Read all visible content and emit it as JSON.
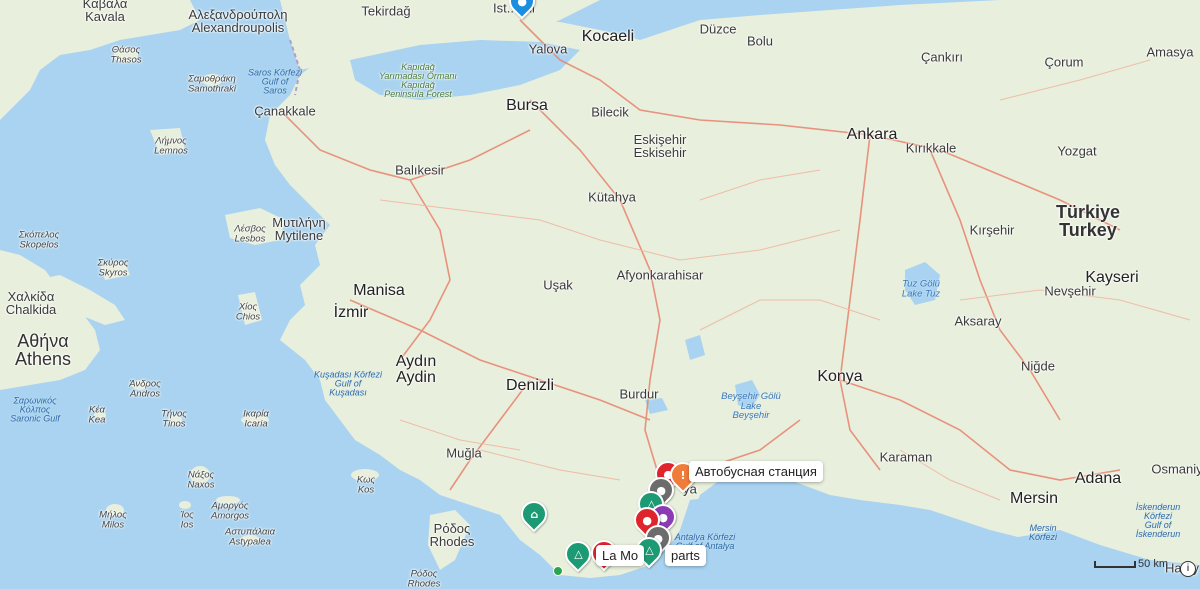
{
  "map": {
    "countries": [
      {
        "id": "turkey",
        "label": "Türkiye\nTurkey"
      },
      {
        "id": "greece",
        "label": "Αθήνα\nAthens"
      }
    ],
    "cities": [
      {
        "id": "istanbul",
        "label": "Ist...bul"
      },
      {
        "id": "tekirdag",
        "label": "Tekirdağ"
      },
      {
        "id": "kavala",
        "label": "Καβάλα\nKavala"
      },
      {
        "id": "alexandroupolis",
        "label": "Αλεξανδρούπολη\nAlexandroupolis"
      },
      {
        "id": "thasos",
        "label": "Θάσος\nThasos"
      },
      {
        "id": "samothraki",
        "label": "Σαμοθράκη\nSamothraki"
      },
      {
        "id": "yalova",
        "label": "Yalova"
      },
      {
        "id": "kocaeli",
        "label": "Kocaeli"
      },
      {
        "id": "duzce",
        "label": "Düzce"
      },
      {
        "id": "bolu",
        "label": "Bolu"
      },
      {
        "id": "cankiri",
        "label": "Çankırı"
      },
      {
        "id": "corum",
        "label": "Çorum"
      },
      {
        "id": "amasya",
        "label": "Amasya"
      },
      {
        "id": "canakkale",
        "label": "Çanakkale"
      },
      {
        "id": "bursa",
        "label": "Bursa"
      },
      {
        "id": "bilecik",
        "label": "Bilecik"
      },
      {
        "id": "eskisehir",
        "label": "Eskişehir\nEskisehir"
      },
      {
        "id": "ankara",
        "label": "Ankara"
      },
      {
        "id": "kirikkale",
        "label": "Kırıkkale"
      },
      {
        "id": "yozgat",
        "label": "Yozgat"
      },
      {
        "id": "lemnos",
        "label": "Λήμνος\nLemnos"
      },
      {
        "id": "balikesir",
        "label": "Balıkesir"
      },
      {
        "id": "kutahya",
        "label": "Kütahya"
      },
      {
        "id": "skopelos",
        "label": "Σκόπελος\nSkopelos"
      },
      {
        "id": "skyros",
        "label": "Σκύρος\nSkyros"
      },
      {
        "id": "lesbos",
        "label": "Λέσβος\nLesbos"
      },
      {
        "id": "mytilene",
        "label": "Μυτιλήνη\nMytilene"
      },
      {
        "id": "kirsehir",
        "label": "Kırşehir"
      },
      {
        "id": "kayseri",
        "label": "Kayseri"
      },
      {
        "id": "chalkida",
        "label": "Χαλκίδα\nChalkida"
      },
      {
        "id": "afyon",
        "label": "Afyonkarahisar"
      },
      {
        "id": "manisa",
        "label": "Manisa"
      },
      {
        "id": "usak",
        "label": "Uşak"
      },
      {
        "id": "nevsehir",
        "label": "Nevşehir"
      },
      {
        "id": "izmir",
        "label": "İzmir"
      },
      {
        "id": "chios",
        "label": "Χίος\nChios"
      },
      {
        "id": "aksaray",
        "label": "Aksaray"
      },
      {
        "id": "aydin",
        "label": "Aydın\nAydin"
      },
      {
        "id": "nigde",
        "label": "Niğde"
      },
      {
        "id": "denizli",
        "label": "Denizli"
      },
      {
        "id": "konya",
        "label": "Konya"
      },
      {
        "id": "andros",
        "label": "Άνδρος\nAndros"
      },
      {
        "id": "burdur",
        "label": "Burdur"
      },
      {
        "id": "kea",
        "label": "Κέα\nKea"
      },
      {
        "id": "tinos",
        "label": "Τήνος\nTinos"
      },
      {
        "id": "ikaria",
        "label": "Ικαρία\nIcaria"
      },
      {
        "id": "mugla",
        "label": "Muğla"
      },
      {
        "id": "karaman",
        "label": "Karaman"
      },
      {
        "id": "kos",
        "label": "Κως\nKos"
      },
      {
        "id": "naxos",
        "label": "Νάξος\nNaxos"
      },
      {
        "id": "osmaniye",
        "label": "Osmaniy"
      },
      {
        "id": "adana",
        "label": "Adana"
      },
      {
        "id": "mersin",
        "label": "Mersin"
      },
      {
        "id": "milos",
        "label": "Μήλος\nMilos"
      },
      {
        "id": "ios",
        "label": "Ίος\nIos"
      },
      {
        "id": "amorgos",
        "label": "Αμοργός\nAmorgos"
      },
      {
        "id": "astypalea",
        "label": "Αστυπάλαια\nAstypalea"
      },
      {
        "id": "rhodes",
        "label": "Ρόδος\nRhodes"
      },
      {
        "id": "rhodes2",
        "label": "Ρόδος\nRhodes"
      },
      {
        "id": "antalya",
        "label": "ya"
      },
      {
        "id": "hatay",
        "label": "Hatay"
      }
    ],
    "water": [
      {
        "id": "saros",
        "label": "Saros Körfezi\nGulf of\nSaros"
      },
      {
        "id": "kusadasi",
        "label": "Kuşadası Körfezi\nGulf of\nKuşadası"
      },
      {
        "id": "saronic",
        "label": "Σαρωνικός\nΚόλπος\nSaronic Gulf"
      },
      {
        "id": "antalya_gulf",
        "label": "Antalya Körfezi\nGulf of Antalya"
      },
      {
        "id": "mersin_gulf",
        "label": "Mersin\nKörfezi"
      },
      {
        "id": "iskenderun",
        "label": "İskenderun\nKörfezi\nGulf of\nİskenderun"
      }
    ],
    "lakes": [
      {
        "id": "tuz",
        "label": "Tuz Gölü\nLake Tuz"
      },
      {
        "id": "beysehir",
        "label": "Beyşehir Gölü\nLake\nBeyşehir"
      }
    ],
    "parks": [
      {
        "id": "kapidag",
        "label": "Kapıdağ\nYarımadası Ormanı\nKapıdağ\nPeninsula Forest"
      }
    ],
    "popups": {
      "bus_station": "Автобусная станция",
      "la_mo": "La Mo",
      "parts": "parts"
    },
    "scale": "50 km",
    "info": "i",
    "colors": {
      "sea": "#a9d3f0",
      "land": "#e8efdc",
      "road_major": "#e8826d",
      "road_minor": "#f0b7a2",
      "border": "#b09fc8",
      "marker_green": "#1c9a73",
      "marker_red": "#e0242e",
      "marker_orange": "#f07c3a",
      "marker_blue": "#1b8ee0"
    },
    "marker_icons": {
      "camping": "tent-icon",
      "hotel": "bed-icon",
      "alert": "exclamation-icon",
      "generic": "pin-icon"
    }
  }
}
